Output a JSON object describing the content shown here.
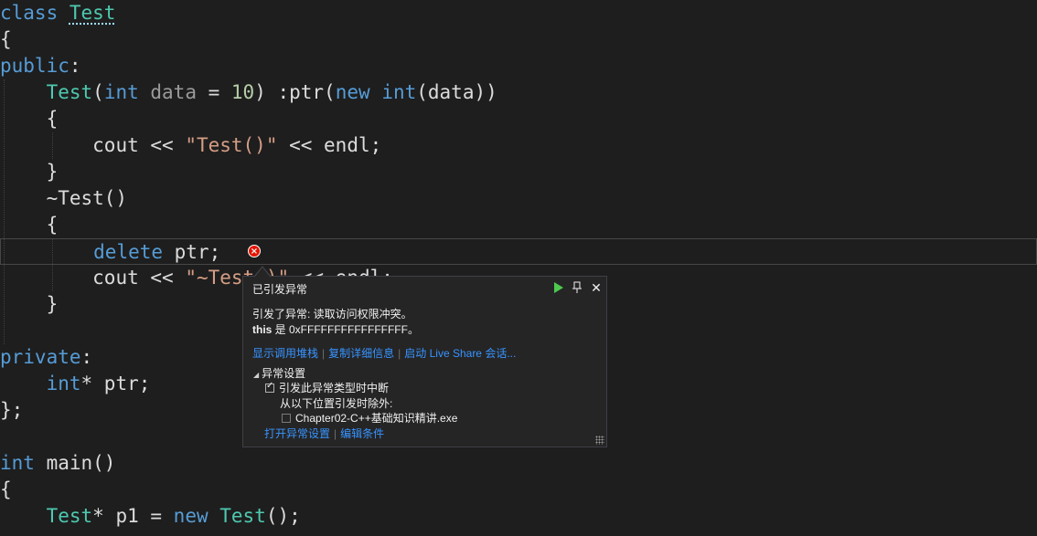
{
  "code": {
    "l1_kw": "class",
    "l1_ty": "Test",
    "l2": "{",
    "l3_kw": "public",
    "l3_colon": ":",
    "l4_ty": "Test",
    "l4_open": "(",
    "l4_int": "int",
    "l4_param": " data",
    "l4_eq": " = ",
    "l4_num": "10",
    "l4_rest": ") :ptr(",
    "l4_new": "new",
    "l4_sp": " ",
    "l4_int2": "int",
    "l4_end": "(data))",
    "l5": "{",
    "l6_a": "cout << ",
    "l6_str": "\"Test()\"",
    "l6_b": " << endl;",
    "l7": "}",
    "l8": "~Test()",
    "l9": "{",
    "l10_kw": "delete",
    "l10_rest": " ptr;",
    "l11_a": "cout << ",
    "l11_str": "\"~Test()\"",
    "l11_b": " << endl;",
    "l12": "}",
    "l14_kw": "private",
    "l14_colon": ":",
    "l15_kw": "int",
    "l15_rest": "* ptr;",
    "l16": "};",
    "l18_kw": "int",
    "l18_rest": " main()",
    "l19": "{",
    "l20_ty": "Test",
    "l20_a": "* p1 = ",
    "l20_new": "new",
    "l20_sp": " ",
    "l20_ty2": "Test",
    "l20_b": "();"
  },
  "error_icon": "error-x-icon",
  "popup": {
    "title": "已引发异常",
    "message_line1": "引发了异常: 读取访问权限冲突。",
    "message_this": "this",
    "message_rest": " 是 0xFFFFFFFFFFFFFFFF。",
    "link_call_stack": "显示调用堆栈",
    "link_copy_details": "复制详细信息",
    "link_live_share": "启动 Live Share 会话...",
    "section_title": "异常设置",
    "check_break_label": "引发此异常类型时中断",
    "check_break_checked": true,
    "except_label": "从以下位置引发时除外:",
    "check_module_label": "Chapter02-C++基础知识精讲.exe",
    "check_module_checked": false,
    "link_open_settings": "打开异常设置",
    "link_edit_conditions": "编辑条件",
    "close_glyph": "✕",
    "pin_glyph": "⊥"
  }
}
